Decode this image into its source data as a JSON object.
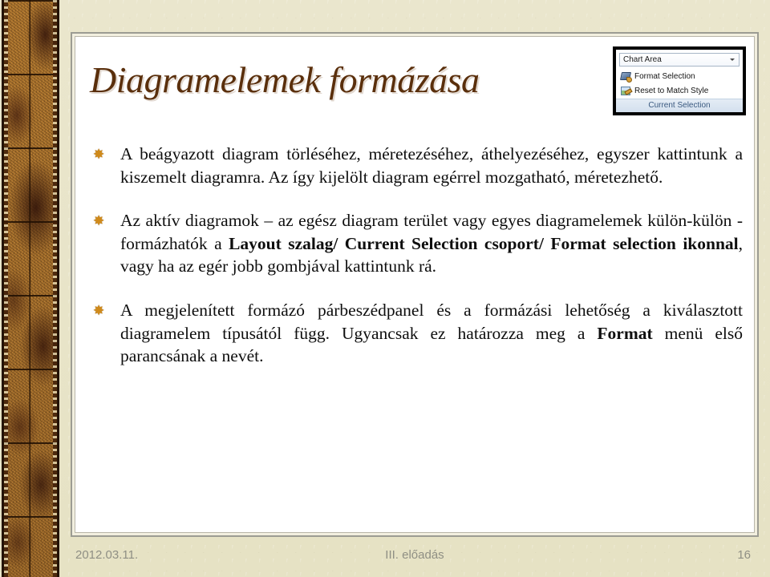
{
  "slide": {
    "title": "Diagramelemek formázása",
    "accent_title_color": "#5A2F0C",
    "bullet_color": "#D08A1A",
    "background_color": "#E9E5CB",
    "page_color": "#FFFFFF"
  },
  "ribbon": {
    "combo_value": "Chart Area",
    "combo_caret_icon": "chevron-down-icon",
    "commands": [
      {
        "label": "Format Selection",
        "icon": "format-selection-icon"
      },
      {
        "label": "Reset to Match Style",
        "icon": "reset-to-match-style-icon"
      }
    ],
    "group_label": "Current Selection"
  },
  "body": {
    "bullet_glyph": "✸",
    "items": [
      {
        "id": "bullet-embedded-chart",
        "segments": [
          {
            "text": "A beágyazott diagram törléséhez, méretezéséhez, áthelyezéséhez, egyszer kattintunk a kiszemelt diagramra. Az így kijelölt diagram egérrel mozgatható, méretezhető.",
            "bold": false
          }
        ]
      },
      {
        "id": "bullet-active-charts",
        "segments": [
          {
            "text": "Az aktív diagramok – az egész diagram terület vagy egyes diagramelemek külön-külön - formázhatók a ",
            "bold": false
          },
          {
            "text": "Layout szalag/ Current Selection csoport/ Format selection ikonnal",
            "bold": true
          },
          {
            "text": ", vagy ha az egér jobb gombjával kattintunk rá.",
            "bold": false
          }
        ]
      },
      {
        "id": "bullet-format-dialog",
        "segments": [
          {
            "text": "A megjelenített formázó párbeszédpanel és a formázási lehetőség a kiválasztott diagramelem típusától függ. Ugyancsak ez határozza meg a ",
            "bold": false
          },
          {
            "text": "Format",
            "bold": true
          },
          {
            "text": " menü első parancsának a nevét.",
            "bold": false
          }
        ]
      }
    ]
  },
  "footer": {
    "date": "2012.03.11.",
    "center": "III. előadás",
    "page_number": "16"
  }
}
